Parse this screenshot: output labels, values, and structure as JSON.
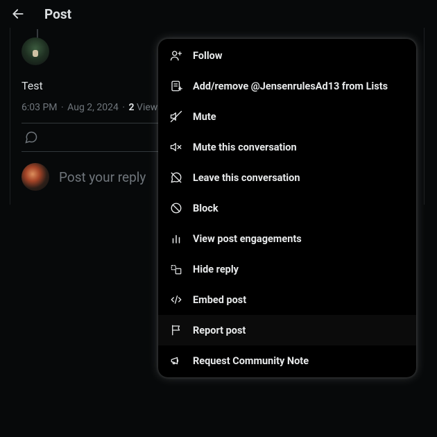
{
  "header": {
    "title": "Post"
  },
  "post": {
    "text": "Test",
    "time": "6:03 PM",
    "date": "Aug 2, 2024",
    "views_n": "2",
    "views_label": "Views"
  },
  "compose": {
    "placeholder": "Post your reply"
  },
  "menu": {
    "items": [
      {
        "icon": "user-plus-icon",
        "label": "Follow"
      },
      {
        "icon": "list-add-icon",
        "label": "Add/remove @JensenrulesAd13 from Lists"
      },
      {
        "icon": "mute-icon",
        "label": "Mute"
      },
      {
        "icon": "mute-convo-icon",
        "label": "Mute this conversation"
      },
      {
        "icon": "leave-convo-icon",
        "label": "Leave this conversation"
      },
      {
        "icon": "block-icon",
        "label": "Block"
      },
      {
        "icon": "chart-icon",
        "label": "View post engagements"
      },
      {
        "icon": "hide-reply-icon",
        "label": "Hide reply"
      },
      {
        "icon": "embed-icon",
        "label": "Embed post"
      },
      {
        "icon": "flag-icon",
        "label": "Report post",
        "hover": true
      },
      {
        "icon": "megaphone-icon",
        "label": "Request Community Note"
      }
    ]
  }
}
